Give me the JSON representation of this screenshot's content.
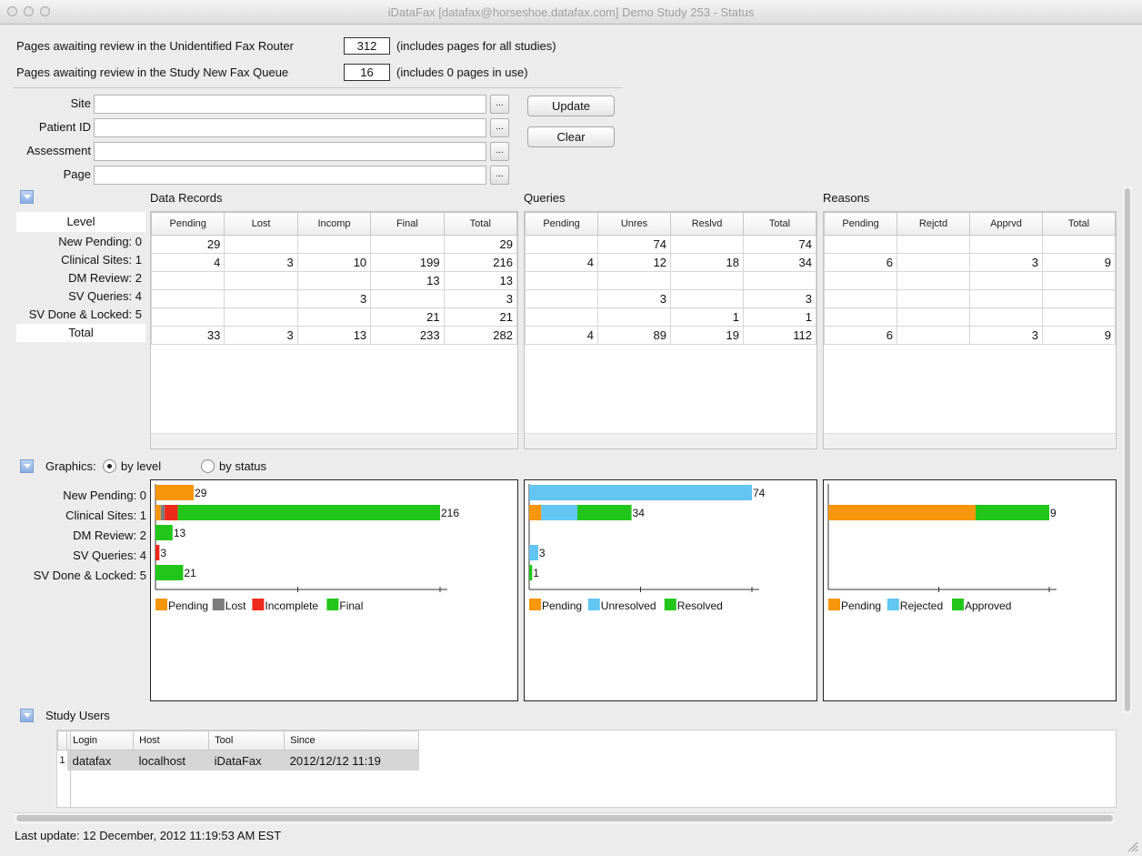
{
  "window": {
    "title": "iDataFax [datafax@horseshoe.datafax.com] Demo Study 253 - Status"
  },
  "summary": {
    "router_label": "Pages awaiting review in the Unidentified Fax Router",
    "router_value": "312",
    "router_note": "(includes pages for all studies)",
    "queue_label": "Pages awaiting review in the Study New Fax Queue",
    "queue_value": "16",
    "queue_note": "(includes 0 pages in use)"
  },
  "filters": {
    "site_label": "Site",
    "patient_label": "Patient ID",
    "assessment_label": "Assessment",
    "page_label": "Page",
    "picker": "...",
    "update": "Update",
    "clear": "Clear"
  },
  "tables": {
    "level_header": "Level",
    "levels": [
      "New Pending: 0",
      "Clinical Sites: 1",
      "DM Review: 2",
      "SV Queries: 4",
      "SV Done & Locked: 5",
      "Total"
    ],
    "data_records": {
      "title": "Data Records",
      "columns": [
        "Pending",
        "Lost",
        "Incomp",
        "Final",
        "Total"
      ],
      "rows": [
        [
          "29",
          "",
          "",
          "",
          "29"
        ],
        [
          "4",
          "3",
          "10",
          "199",
          "216"
        ],
        [
          "",
          "",
          "",
          "13",
          "13"
        ],
        [
          "",
          "",
          "3",
          "",
          "3"
        ],
        [
          "",
          "",
          "",
          "21",
          "21"
        ],
        [
          "33",
          "3",
          "13",
          "233",
          "282"
        ]
      ]
    },
    "queries": {
      "title": "Queries",
      "columns": [
        "Pending",
        "Unres",
        "Reslvd",
        "Total"
      ],
      "rows": [
        [
          "",
          "74",
          "",
          "74"
        ],
        [
          "4",
          "12",
          "18",
          "34"
        ],
        [
          "",
          "",
          "",
          ""
        ],
        [
          "",
          "3",
          "",
          "3"
        ],
        [
          "",
          "",
          "1",
          "1"
        ],
        [
          "4",
          "89",
          "19",
          "112"
        ]
      ]
    },
    "reasons": {
      "title": "Reasons",
      "columns": [
        "Pending",
        "Rejctd",
        "Apprvd",
        "Total"
      ],
      "rows": [
        [
          "",
          "",
          "",
          ""
        ],
        [
          "6",
          "",
          "3",
          "9"
        ],
        [
          "",
          "",
          "",
          ""
        ],
        [
          "",
          "",
          "",
          ""
        ],
        [
          "",
          "",
          "",
          ""
        ],
        [
          "6",
          "",
          "3",
          "9"
        ]
      ]
    }
  },
  "graphics": {
    "label": "Graphics:",
    "option_level": "by level",
    "option_status": "by status",
    "selected": "by level",
    "levels": [
      "New Pending: 0",
      "Clinical Sites: 1",
      "DM Review: 2",
      "SV Queries: 4",
      "SV Done & Locked: 5"
    ]
  },
  "chart_data": [
    {
      "type": "bar",
      "stacked": true,
      "orientation": "horizontal",
      "categories": [
        "New Pending: 0",
        "Clinical Sites: 1",
        "DM Review: 2",
        "SV Queries: 4",
        "SV Done & Locked: 5"
      ],
      "series": [
        {
          "name": "Pending",
          "color": "#f7960b",
          "values": [
            29,
            4,
            0,
            0,
            0
          ]
        },
        {
          "name": "Lost",
          "color": "#7d7d7d",
          "values": [
            0,
            3,
            0,
            0,
            0
          ]
        },
        {
          "name": "Incomplete",
          "color": "#ee2a1b",
          "values": [
            0,
            10,
            0,
            3,
            0
          ]
        },
        {
          "name": "Final",
          "color": "#22c61a",
          "values": [
            0,
            199,
            13,
            0,
            21
          ]
        }
      ],
      "totals": [
        "29",
        "216",
        "13",
        "3",
        "21"
      ],
      "xlim": [
        0,
        216
      ],
      "legend": "bottom"
    },
    {
      "type": "bar",
      "stacked": true,
      "orientation": "horizontal",
      "categories": [
        "New Pending: 0",
        "Clinical Sites: 1",
        "DM Review: 2",
        "SV Queries: 4",
        "SV Done & Locked: 5"
      ],
      "series": [
        {
          "name": "Pending",
          "color": "#f7960b",
          "values": [
            0,
            4,
            0,
            0,
            0
          ]
        },
        {
          "name": "Unresolved",
          "color": "#62c5f2",
          "values": [
            74,
            12,
            0,
            3,
            0
          ]
        },
        {
          "name": "Resolved",
          "color": "#22c61a",
          "values": [
            0,
            18,
            0,
            0,
            1
          ]
        }
      ],
      "totals": [
        "74",
        "34",
        "",
        "3",
        "1"
      ],
      "xlim": [
        0,
        74
      ],
      "legend": "bottom"
    },
    {
      "type": "bar",
      "stacked": true,
      "orientation": "horizontal",
      "categories": [
        "New Pending: 0",
        "Clinical Sites: 1",
        "DM Review: 2",
        "SV Queries: 4",
        "SV Done & Locked: 5"
      ],
      "series": [
        {
          "name": "Pending",
          "color": "#f7960b",
          "values": [
            0,
            6,
            0,
            0,
            0
          ]
        },
        {
          "name": "Rejected",
          "color": "#62c5f2",
          "values": [
            0,
            0,
            0,
            0,
            0
          ]
        },
        {
          "name": "Approved",
          "color": "#22c61a",
          "values": [
            0,
            3,
            0,
            0,
            0
          ]
        }
      ],
      "totals": [
        "",
        "9",
        "",
        "",
        ""
      ],
      "xlim": [
        0,
        9
      ],
      "legend": "bottom"
    }
  ],
  "users": {
    "title": "Study Users",
    "columns": [
      "Login",
      "Host",
      "Tool",
      "Since"
    ],
    "rows": [
      {
        "num": "1",
        "login": "datafax",
        "host": "localhost",
        "tool": "iDataFax",
        "since": "2012/12/12 11:19"
      }
    ]
  },
  "status": {
    "last_update": "Last update: 12 December, 2012 11:19:53 AM EST"
  }
}
